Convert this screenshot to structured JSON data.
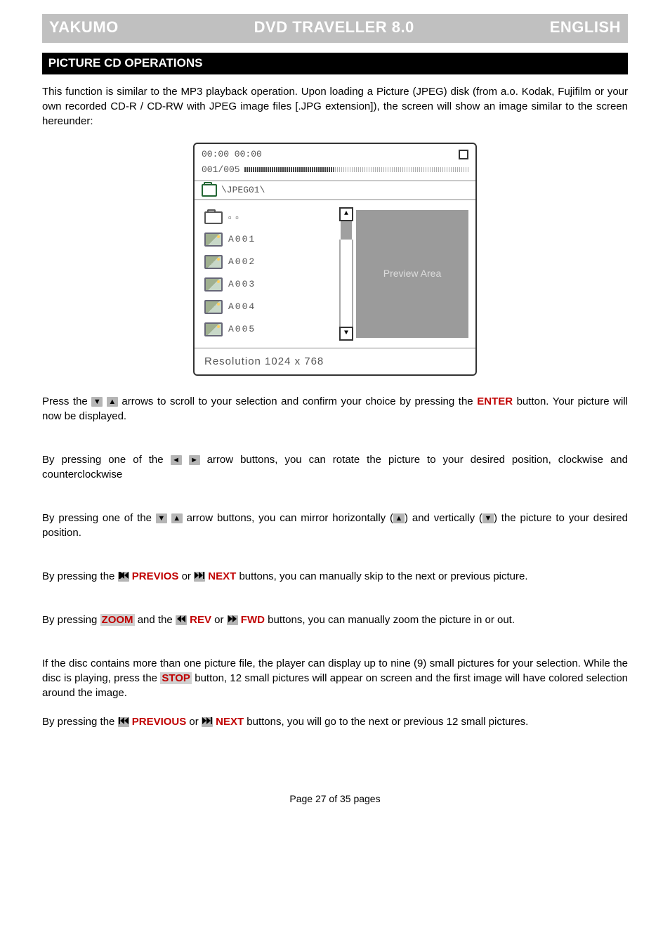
{
  "header": {
    "brand": "YAKUMO",
    "title": "DVD TRAVELLER 8.0",
    "lang": "ENGLISH"
  },
  "section_title": "PICTURE CD OPERATIONS",
  "intro": "This function is similar to the MP3 playback operation. Upon loading a Picture (JPEG) disk (from a.o. Kodak, Fujifilm or your own recorded CD-R / CD-RW with JPEG image files [.JPG extension]), the screen will show an image similar to the screen hereunder:",
  "player": {
    "time": "00:00  00:00",
    "counter": "001/005",
    "path": "\\JPEG01\\",
    "updir": "�  �",
    "files": [
      "A001",
      "A002",
      "A003",
      "A004",
      "A005"
    ],
    "preview_label": "Preview Area",
    "resolution_label": "Resolution   1024 x 768"
  },
  "p1_a": "Press the ",
  "p1_b": " arrows to scroll to your selection and confirm your choice by pressing the ",
  "p1_enter": "ENTER",
  "p1_c": " button. Your picture will now be displayed.",
  "p2_a": "By pressing one of the ",
  "p2_b": " arrow buttons, you can rotate the picture to your desired position, clockwise and counterclockwise",
  "p3_a": "By pressing one of the ",
  "p3_b": " arrow buttons, you can mirror horizontally (",
  "p3_c": ") and vertically (",
  "p3_d": ") the picture to your desired position.",
  "p4_a": "By pressing the ",
  "p4_prev": " PREVIOS",
  "p4_or": " or ",
  "p4_next": " NEXT",
  "p4_b": " buttons, you can manually skip to the next or previous picture.",
  "p5_a": "By pressing ",
  "p5_zoom": "ZOOM",
  "p5_b": " and the ",
  "p5_rev": " REV",
  "p5_fwd": " FWD",
  "p5_c": " buttons, you can manually zoom the picture in or out.",
  "p6_a": "If the disc contains more than one picture file, the player can display up to nine (9) small pictures for your selection. While the disc is playing, press the ",
  "p6_stop": "STOP",
  "p6_b": " button, 12 small pictures will appear on screen and the first image will have colored selection around the image.",
  "p7_a": "By pressing the  ",
  "p7_prev": " PREVIOUS",
  "p7_next": " NEXT",
  "p7_b": " buttons, you will go to the next or previous 12 small pictures.",
  "footer": "Page 27 of 35 pages"
}
